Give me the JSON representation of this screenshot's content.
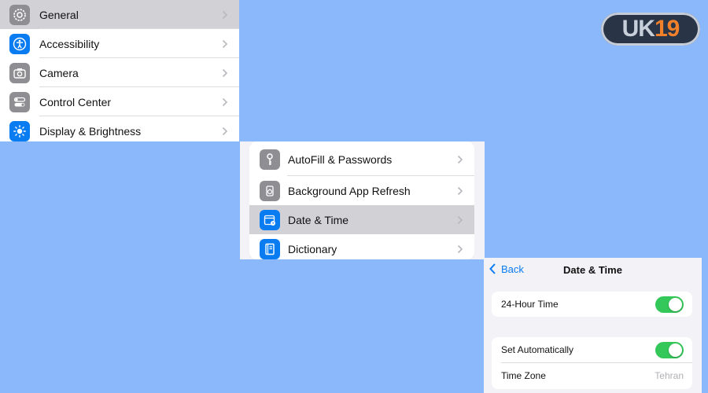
{
  "settings_list": {
    "items": [
      {
        "label": "General",
        "icon": "gear-icon",
        "color": "#8e8e93",
        "selected": true
      },
      {
        "label": "Accessibility",
        "icon": "accessibility-icon",
        "color": "#0a7cf2"
      },
      {
        "label": "Camera",
        "icon": "camera-icon",
        "color": "#8e8e93"
      },
      {
        "label": "Control Center",
        "icon": "toggles-icon",
        "color": "#8e8e93"
      },
      {
        "label": "Display & Brightness",
        "icon": "sun-icon",
        "color": "#0a7cf2"
      }
    ]
  },
  "general_list": {
    "items": [
      {
        "label": "AutoFill & Passwords",
        "icon": "key-icon",
        "color": "#8e8e93"
      },
      {
        "label": "Background App Refresh",
        "icon": "refresh-app-icon",
        "color": "#8e8e93"
      },
      {
        "label": "Date & Time",
        "icon": "calendar-clock-icon",
        "color": "#0a7cf2",
        "selected": true
      },
      {
        "label": "Dictionary",
        "icon": "book-icon",
        "color": "#0a7cf2"
      }
    ]
  },
  "date_time": {
    "back_label": "Back",
    "title": "Date & Time",
    "hour24": {
      "label": "24-Hour Time",
      "on": true
    },
    "set_auto": {
      "label": "Set Automatically",
      "on": true
    },
    "time_zone": {
      "label": "Time Zone",
      "value": "Tehran"
    }
  },
  "logo": {
    "text_left": "UK",
    "text_right": "19"
  },
  "colors": {
    "background": "#8ab8fa",
    "accent": "#0a7cf2",
    "toggle_on": "#34c759",
    "selection": "#d1d1d6"
  }
}
